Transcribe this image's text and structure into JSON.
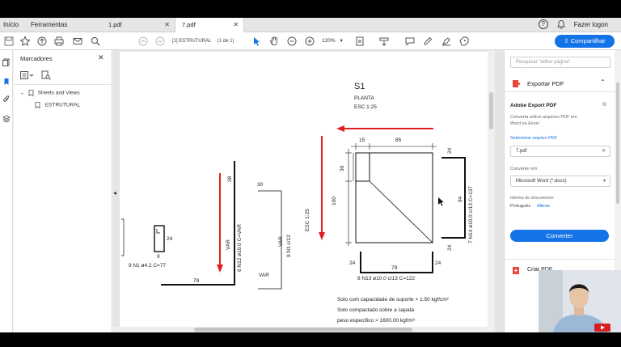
{
  "tabs": {
    "home": "Início",
    "tools": "Ferramentas",
    "doc1": "1.pdf",
    "doc2": "7.pdf",
    "login": "Fazer logon"
  },
  "toolbar": {
    "page_label": "[1] ESTRUTURAL",
    "page_count": "(1 de 1)",
    "zoom": "120%",
    "share_label": "Compartilhar"
  },
  "bookmarks": {
    "title": "Marcadores",
    "tree": [
      {
        "label": "Sheets and Views",
        "expanded": true
      },
      {
        "label": "ESTRUTURAL"
      }
    ]
  },
  "drawing": {
    "title": "S1",
    "subtitle": "PLANTA",
    "scale": "ESC 1:25",
    "side_scale": "ESC 1:25",
    "dims": {
      "top_15": "15",
      "top_85": "85",
      "left_30": "30",
      "left_100": "100",
      "right_24a": "24",
      "right_94": "94",
      "right_24b": "24",
      "bot_24a": "24",
      "bot_79": "79",
      "bot_24b": "24"
    },
    "bars": {
      "n14": "7 N14 ø10.0 c/13  C=137",
      "n13": "8 N13 ø10.0 c/13  C=122",
      "n12": "6 N12 ø10.0  C=VAR",
      "n12_var": "VAR",
      "n12_top": "38",
      "n12_bottom": "79",
      "n1_side": "9 N1 c/12",
      "n1_var_a": "VAR",
      "n1_var_b": "VAR",
      "n1_top": "30",
      "stirrup_w": "9",
      "stirrup_h": "24",
      "stirrup_label": "9 N1 ø4.2  C=77"
    },
    "notes": [
      "Solo com capacidade de suporte > 1.50 kgf/cm²",
      "Solo compactado sobre a sapata",
      "peso específico > 1600.00 kgf/m³"
    ],
    "arrow_color": "#e02020"
  },
  "right_pane": {
    "search_placeholder": "Pesquisar \"editar página\"",
    "section_title": "Exportar PDF",
    "tool_name": "Adobe Export PDF",
    "tool_desc_1": "Converta online arquivos PDF em",
    "tool_desc_2": "Word ou Excel",
    "select_file_label": "Selecionar arquivo PDF",
    "file_value": "7.pdf",
    "convert_to_label": "Converter em",
    "convert_to_value": "Microsoft Word (*.docx)",
    "doc_lang_label": "Idioma do documento:",
    "doc_lang_value": "Português",
    "change_link": "Alterar",
    "convert_button": "Converter",
    "next_section": "Criar PDF"
  }
}
